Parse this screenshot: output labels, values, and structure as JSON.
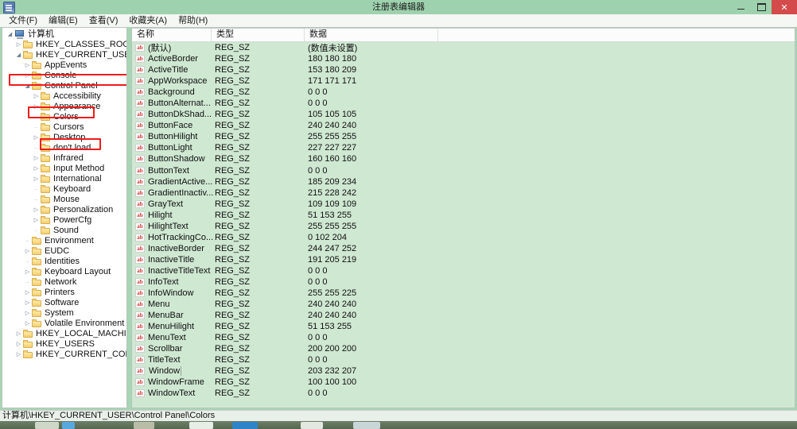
{
  "window": {
    "title": "注册表编辑器",
    "icon": "registry-editor-icon",
    "minimize_label": "–",
    "maximize_label": "❐",
    "close_label": "✕",
    "accent_title_bg": "#9ed2ae",
    "close_bg": "#d44b4b",
    "list_bg": "#cfe8d2",
    "annotation_color": "#ef1c1c"
  },
  "menu": {
    "items": [
      {
        "label": "文件(F)"
      },
      {
        "label": "编辑(E)"
      },
      {
        "label": "查看(V)"
      },
      {
        "label": "收藏夹(A)"
      },
      {
        "label": "帮助(H)"
      }
    ]
  },
  "tree": {
    "nodes": [
      {
        "label": "计算机",
        "indent": 0,
        "twist": "▲",
        "icon": "computer-icon"
      },
      {
        "label": "HKEY_CLASSES_ROOT",
        "indent": 1,
        "twist": "▷",
        "icon": "folder-icon"
      },
      {
        "label": "HKEY_CURRENT_USER",
        "indent": 1,
        "twist": "▲",
        "icon": "folder-icon",
        "highlight": true
      },
      {
        "label": "AppEvents",
        "indent": 2,
        "twist": "▷",
        "icon": "folder-icon"
      },
      {
        "label": "Console",
        "indent": 2,
        "twist": "▷",
        "icon": "folder-icon"
      },
      {
        "label": "Control Panel",
        "indent": 2,
        "twist": "▲",
        "icon": "folder-icon",
        "highlight": true
      },
      {
        "label": "Accessibility",
        "indent": 3,
        "twist": "▷",
        "icon": "folder-icon"
      },
      {
        "label": "Appearance",
        "indent": 3,
        "twist": "▷",
        "icon": "folder-icon"
      },
      {
        "label": "Colors",
        "indent": 3,
        "twist": "",
        "icon": "folder-icon",
        "highlight": true
      },
      {
        "label": "Cursors",
        "indent": 3,
        "twist": "",
        "icon": "folder-icon"
      },
      {
        "label": "Desktop",
        "indent": 3,
        "twist": "▷",
        "icon": "folder-icon"
      },
      {
        "label": "don't load",
        "indent": 3,
        "twist": "",
        "icon": "folder-icon"
      },
      {
        "label": "Infrared",
        "indent": 3,
        "twist": "▷",
        "icon": "folder-icon"
      },
      {
        "label": "Input Method",
        "indent": 3,
        "twist": "▷",
        "icon": "folder-icon"
      },
      {
        "label": "International",
        "indent": 3,
        "twist": "▷",
        "icon": "folder-icon"
      },
      {
        "label": "Keyboard",
        "indent": 3,
        "twist": "",
        "icon": "folder-icon"
      },
      {
        "label": "Mouse",
        "indent": 3,
        "twist": "",
        "icon": "folder-icon"
      },
      {
        "label": "Personalization",
        "indent": 3,
        "twist": "▷",
        "icon": "folder-icon"
      },
      {
        "label": "PowerCfg",
        "indent": 3,
        "twist": "▷",
        "icon": "folder-icon"
      },
      {
        "label": "Sound",
        "indent": 3,
        "twist": "",
        "icon": "folder-icon"
      },
      {
        "label": "Environment",
        "indent": 2,
        "twist": "",
        "icon": "folder-icon"
      },
      {
        "label": "EUDC",
        "indent": 2,
        "twist": "▷",
        "icon": "folder-icon"
      },
      {
        "label": "Identities",
        "indent": 2,
        "twist": "",
        "icon": "folder-icon"
      },
      {
        "label": "Keyboard Layout",
        "indent": 2,
        "twist": "▷",
        "icon": "folder-icon"
      },
      {
        "label": "Network",
        "indent": 2,
        "twist": "",
        "icon": "folder-icon"
      },
      {
        "label": "Printers",
        "indent": 2,
        "twist": "▷",
        "icon": "folder-icon"
      },
      {
        "label": "Software",
        "indent": 2,
        "twist": "▷",
        "icon": "folder-icon"
      },
      {
        "label": "System",
        "indent": 2,
        "twist": "▷",
        "icon": "folder-icon"
      },
      {
        "label": "Volatile Environment",
        "indent": 2,
        "twist": "▷",
        "icon": "folder-icon"
      },
      {
        "label": "HKEY_LOCAL_MACHINE",
        "indent": 1,
        "twist": "▷",
        "icon": "folder-icon"
      },
      {
        "label": "HKEY_USERS",
        "indent": 1,
        "twist": "▷",
        "icon": "folder-icon"
      },
      {
        "label": "HKEY_CURRENT_CONFIG",
        "indent": 1,
        "twist": "▷",
        "icon": "folder-icon"
      }
    ]
  },
  "list": {
    "columns": [
      {
        "label": "名称"
      },
      {
        "label": "类型"
      },
      {
        "label": "数据"
      }
    ],
    "rows": [
      {
        "name": "(默认)",
        "type": "REG_SZ",
        "data": "(数值未设置)"
      },
      {
        "name": "ActiveBorder",
        "type": "REG_SZ",
        "data": "180 180 180"
      },
      {
        "name": "ActiveTitle",
        "type": "REG_SZ",
        "data": "153 180 209"
      },
      {
        "name": "AppWorkspace",
        "type": "REG_SZ",
        "data": "171 171 171"
      },
      {
        "name": "Background",
        "type": "REG_SZ",
        "data": "0 0 0"
      },
      {
        "name": "ButtonAlternat...",
        "type": "REG_SZ",
        "data": "0 0 0"
      },
      {
        "name": "ButtonDkShad...",
        "type": "REG_SZ",
        "data": "105 105 105"
      },
      {
        "name": "ButtonFace",
        "type": "REG_SZ",
        "data": "240 240 240"
      },
      {
        "name": "ButtonHilight",
        "type": "REG_SZ",
        "data": "255 255 255"
      },
      {
        "name": "ButtonLight",
        "type": "REG_SZ",
        "data": "227 227 227"
      },
      {
        "name": "ButtonShadow",
        "type": "REG_SZ",
        "data": "160 160 160"
      },
      {
        "name": "ButtonText",
        "type": "REG_SZ",
        "data": "0 0 0"
      },
      {
        "name": "GradientActive...",
        "type": "REG_SZ",
        "data": "185 209 234"
      },
      {
        "name": "GradientInactiv...",
        "type": "REG_SZ",
        "data": "215 228 242"
      },
      {
        "name": "GrayText",
        "type": "REG_SZ",
        "data": "109 109 109"
      },
      {
        "name": "Hilight",
        "type": "REG_SZ",
        "data": "51 153 255"
      },
      {
        "name": "HilightText",
        "type": "REG_SZ",
        "data": "255 255 255"
      },
      {
        "name": "HotTrackingCo...",
        "type": "REG_SZ",
        "data": "0 102 204"
      },
      {
        "name": "InactiveBorder",
        "type": "REG_SZ",
        "data": "244 247 252"
      },
      {
        "name": "InactiveTitle",
        "type": "REG_SZ",
        "data": "191 205 219"
      },
      {
        "name": "InactiveTitleText",
        "type": "REG_SZ",
        "data": "0 0 0"
      },
      {
        "name": "InfoText",
        "type": "REG_SZ",
        "data": "0 0 0"
      },
      {
        "name": "InfoWindow",
        "type": "REG_SZ",
        "data": "255 255 225"
      },
      {
        "name": "Menu",
        "type": "REG_SZ",
        "data": "240 240 240"
      },
      {
        "name": "MenuBar",
        "type": "REG_SZ",
        "data": "240 240 240"
      },
      {
        "name": "MenuHilight",
        "type": "REG_SZ",
        "data": "51 153 255"
      },
      {
        "name": "MenuText",
        "type": "REG_SZ",
        "data": "0 0 0"
      },
      {
        "name": "Scrollbar",
        "type": "REG_SZ",
        "data": "200 200 200"
      },
      {
        "name": "TitleText",
        "type": "REG_SZ",
        "data": "0 0 0"
      },
      {
        "name": "Window",
        "type": "REG_SZ",
        "data": "203 232 207",
        "selected": true
      },
      {
        "name": "WindowFrame",
        "type": "REG_SZ",
        "data": "100 100 100"
      },
      {
        "name": "WindowText",
        "type": "REG_SZ",
        "data": "0 0 0"
      }
    ]
  },
  "status": {
    "path": "计算机\\HKEY_CURRENT_USER\\Control Panel\\Colors"
  }
}
